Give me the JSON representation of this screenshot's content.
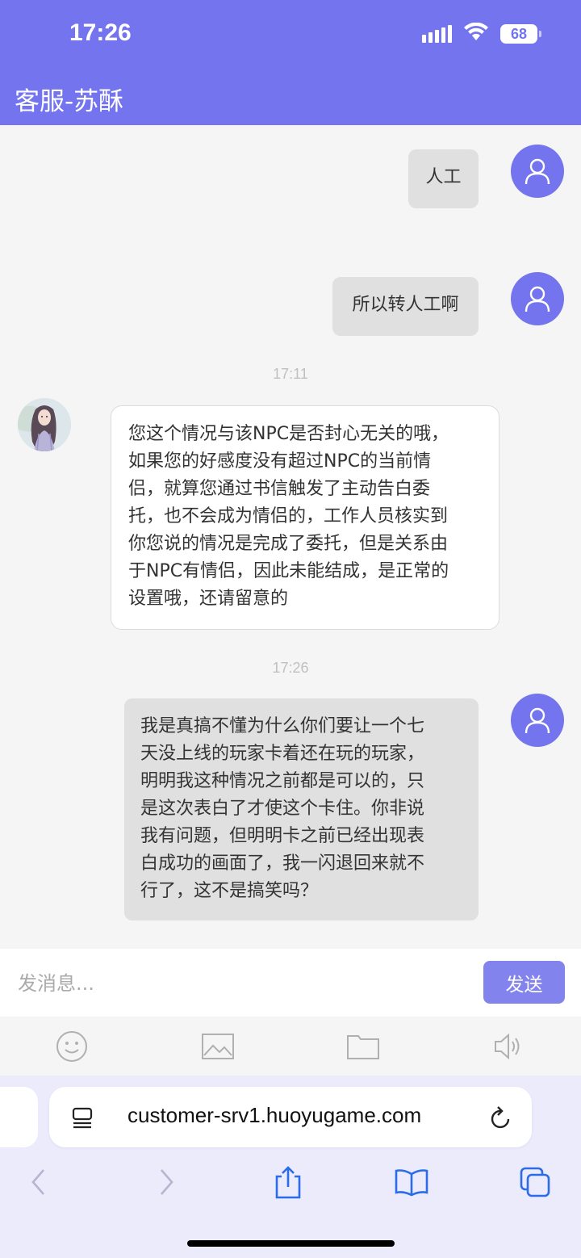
{
  "status_bar": {
    "time": "17:26",
    "battery": "68"
  },
  "header": {
    "title": "客服-苏酥"
  },
  "messages": [
    {
      "from": "me",
      "text": "人工"
    },
    {
      "from": "me",
      "text": "所以转人工啊"
    },
    {
      "time": "17:11"
    },
    {
      "from": "agent",
      "lines": [
        "您这个情况与该NPC是否封心无关的哦，",
        "如果您的好感度没有超过NPC的当前情",
        "侣，就算您通过书信触发了主动告白委",
        "托，也不会成为情侣的，工作人员核实到",
        "你您说的情况是完成了委托，但是关系由",
        "于NPC有情侣，因此未能结成，是正常的",
        "设置哦，还请留意的"
      ]
    },
    {
      "time": "17:26"
    },
    {
      "from": "me",
      "lines": [
        "我是真搞不懂为什么你们要让一个七",
        "天没上线的玩家卡着还在玩的玩家，",
        "明明我这种情况之前都是可以的，只",
        "是这次表白了才使这个卡住。你非说",
        "我有问题，但明明卡之前已经出现表",
        "白成功的画面了，我一闪退回来就不",
        "行了，这不是搞笑吗？"
      ]
    }
  ],
  "input": {
    "placeholder": "发消息...",
    "value": ""
  },
  "send_button": {
    "label": "发送"
  },
  "toolbar": {
    "icons": [
      "emoji-icon",
      "image-icon",
      "folder-icon",
      "speaker-icon"
    ]
  },
  "browser": {
    "url": "customer-srv1.huoyugame.com"
  },
  "colors": {
    "accent": "#7474ee",
    "send": "#8383ee",
    "my_bubble": "#e0e0e0",
    "agent_bubble": "#ffffff"
  }
}
